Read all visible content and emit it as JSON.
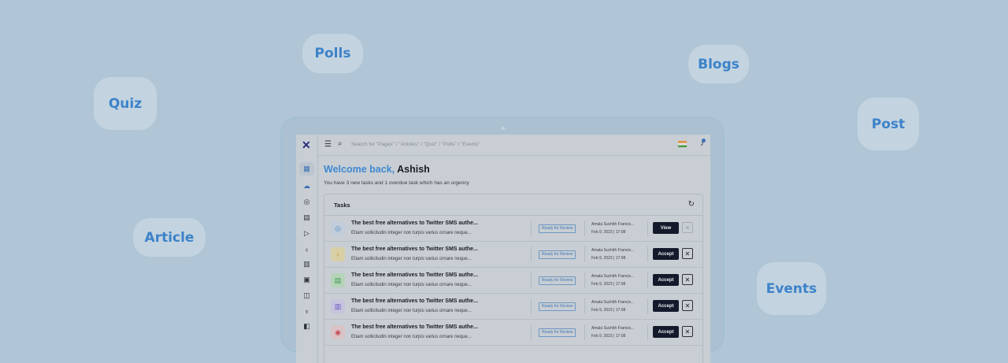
{
  "bubbles": {
    "polls": "Polls",
    "quiz": "Quiz",
    "blogs": "Blogs",
    "post": "Post",
    "article": "Article",
    "events": "Events"
  },
  "app": {
    "logo": "✕",
    "search": {
      "placeholder": "Search for \"Pages\" / \"Articles\" / \"Quiz\" / \"Polls\" / \"Events\""
    },
    "welcome_prefix": "Welcome back,",
    "user_name": "Ashish",
    "subtitle": "You have 3 new tasks and 1 overdue task which has an urgency",
    "tasks": {
      "title": "Tasks",
      "rows": [
        {
          "icon": "globe-icon",
          "title": "The best free alternatives to Twitter SMS authe...",
          "desc": "Etiam sollicitudin integer non turpis varius ornare neque...",
          "status": "Ready for Review",
          "author": "Amala Suchith Francis...",
          "date": "Feb 9, 2023 | 17:08",
          "action": "View"
        },
        {
          "icon": "bulb-icon",
          "title": "The best free alternatives to Twitter SMS authe...",
          "desc": "Etiam sollicitudin integer non turpis varius ornare neque...",
          "status": "Ready for Review",
          "author": "Amala Suchith Francis...",
          "date": "Feb 9, 2023 | 17:08",
          "action": "Accept"
        },
        {
          "icon": "document-icon",
          "title": "The best free alternatives to Twitter SMS authe...",
          "desc": "Etiam sollicitudin integer non turpis varius ornare neque...",
          "status": "Ready for Review",
          "author": "Amala Suchith Francis...",
          "date": "Feb 9, 2023 | 17:08",
          "action": "Accept"
        },
        {
          "icon": "bar-chart-icon",
          "title": "The best free alternatives to Twitter SMS authe...",
          "desc": "Etiam sollicitudin integer non turpis varius ornare neque...",
          "status": "Ready for Review",
          "author": "Amala Suchith Francis...",
          "date": "Feb 9, 2023 | 17:08",
          "action": "Accept"
        },
        {
          "icon": "play-icon",
          "title": "The best free alternatives to Twitter SMS authe...",
          "desc": "Etiam sollicitudin integer non turpis varius ornare neque...",
          "status": "Ready for Review",
          "author": "Amala Suchith Francis...",
          "date": "Feb 9, 2023 | 17:08",
          "action": "Accept"
        }
      ]
    }
  },
  "colors": {
    "background": "#b0c6d6",
    "accent": "#3f88d2",
    "button_dark": "#141a2b"
  }
}
